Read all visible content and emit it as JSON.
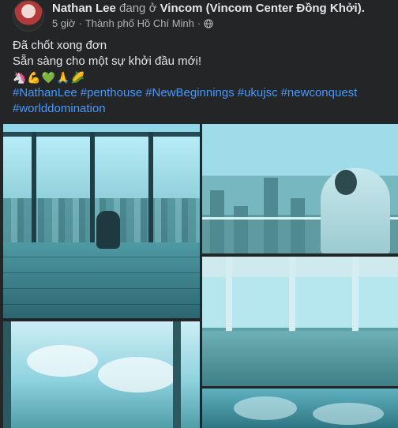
{
  "post": {
    "author": "Nathan Lee",
    "verb": "đang ở",
    "place": "Vincom (Vincom Center Đồng Khởi).",
    "time": "5 giờ",
    "location": "Thành phố Hồ Chí Minh",
    "visibility_icon": "globe-icon",
    "lines": [
      "Đã chốt xong đơn",
      "Sẵn sàng cho một sự khởi đầu mới!"
    ],
    "emojis": "🦄💪💚🙏🌽",
    "hashtags": [
      "#NathanLee",
      "#penthouse",
      "#NewBeginnings",
      "#ukujsc",
      "#newconquest",
      "#worlddomination"
    ]
  },
  "colors": {
    "background": "#242526",
    "text": "#e4e6eb",
    "secondary": "#b0b3b8",
    "link": "#4599ff"
  }
}
